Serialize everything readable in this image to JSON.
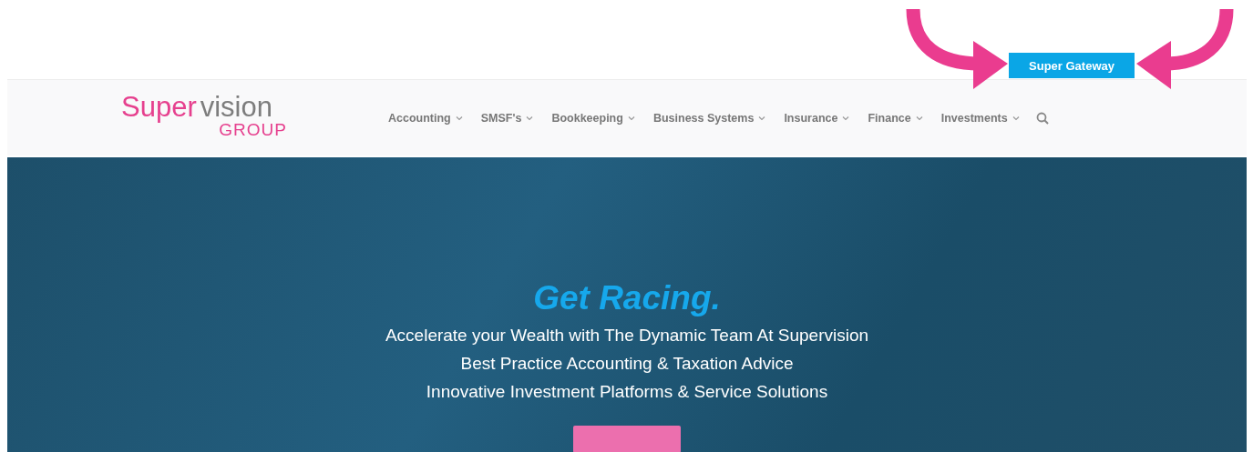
{
  "top_bar": {
    "button": "Super Gateway"
  },
  "logo": {
    "word_1": "Super",
    "word_2": "vision",
    "subtitle": "GROUP"
  },
  "nav": {
    "items": [
      {
        "label": "Accounting",
        "has_menu": true
      },
      {
        "label": "SMSF's",
        "has_menu": true
      },
      {
        "label": "Bookkeeping",
        "has_menu": true
      },
      {
        "label": "Business Systems",
        "has_menu": true
      },
      {
        "label": "Insurance",
        "has_menu": true
      },
      {
        "label": "Finance",
        "has_menu": true
      },
      {
        "label": "Investments",
        "has_menu": true
      }
    ]
  },
  "hero": {
    "heading": "Get Racing.",
    "lines": [
      "Accelerate your Wealth with The Dynamic Team At Supervision",
      "Best Practice Accounting & Taxation Advice",
      "Innovative Investment Platforms & Service Solutions"
    ]
  }
}
